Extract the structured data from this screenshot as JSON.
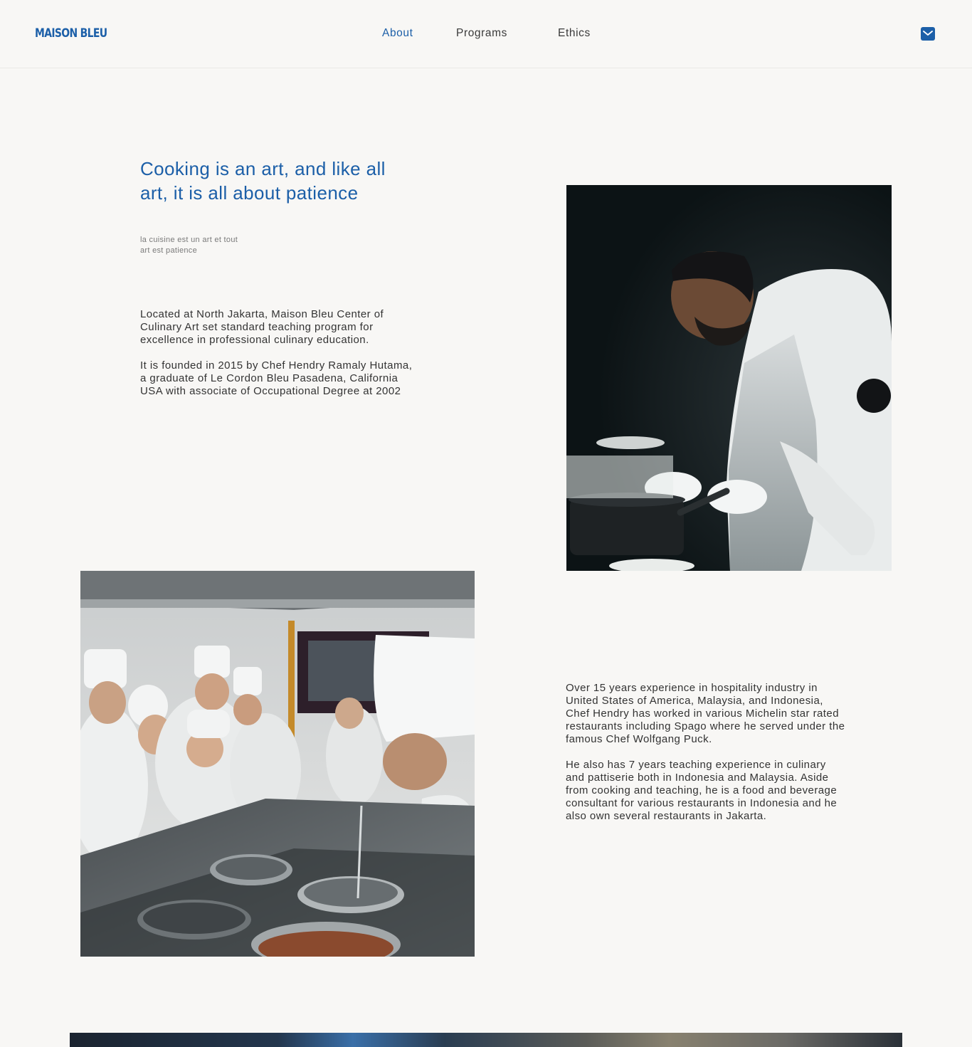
{
  "header": {
    "logo": "MAISON BLEU",
    "nav": [
      {
        "label": "About",
        "active": true
      },
      {
        "label": "Programs",
        "active": false
      },
      {
        "label": "Ethics",
        "active": false
      }
    ],
    "contact_icon": "mail-icon"
  },
  "hero": {
    "headline_line1": "Cooking is an art, and like all",
    "headline_line2": "art, it is all about patience",
    "subtitle_line1": "la cuisine est un art et tout",
    "subtitle_line2": "art est patience"
  },
  "intro": {
    "p1": "Located at North Jakarta, Maison Bleu Center of Culinary Art set standard teaching program for excellence in professional culinary education.",
    "p2": "It is founded in 2015 by Chef Hendry Ramaly Hutama, a graduate of Le Cordon Bleu Pasadena, California USA with associate of Occupational Degree at 2002"
  },
  "bio": {
    "p1": "Over 15 years experience in hospitality industry in United States of America, Malaysia, and Indonesia, Chef Hendry has worked in various Michelin star rated restaurants including Spago where he served under the famous Chef Wolfgang Puck.",
    "p2": "He also has 7 years teaching experience in culinary and pattiserie both in Indonesia and Malaysia. Aside from cooking and teaching, he is a food and beverage consultant for various restaurants in Indonesia and he also own several restaurants in Jakarta."
  },
  "colors": {
    "accent": "#1c5fa8",
    "background": "#f8f7f5",
    "text": "#333333"
  }
}
